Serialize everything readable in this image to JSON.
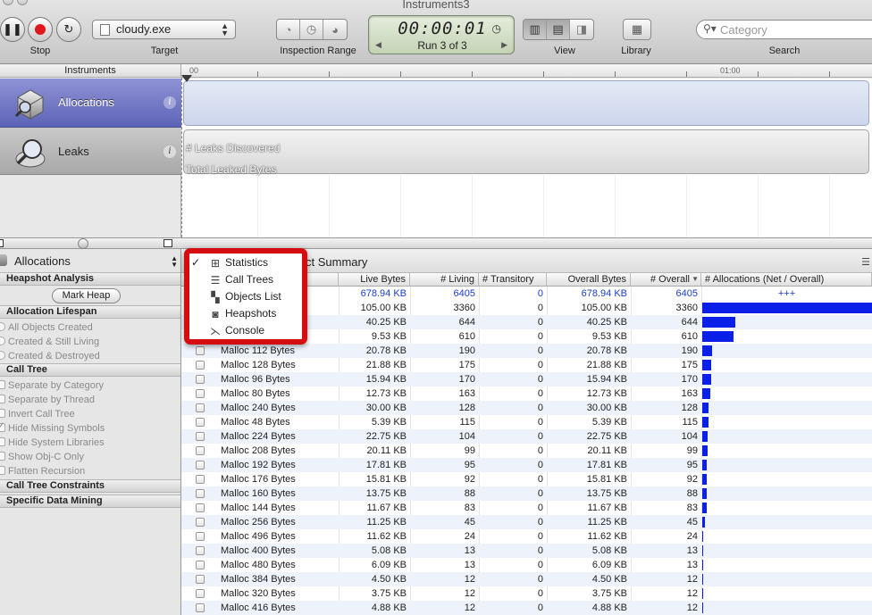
{
  "window": {
    "title": "Instruments3"
  },
  "toolbar": {
    "stop_label": "Stop",
    "target_label": "Target",
    "target_value": "cloudy.exe",
    "inspection_range_label": "Inspection Range",
    "timer": "00:00:01",
    "run": "Run 3 of 3",
    "view_label": "View",
    "library_label": "Library",
    "search_label": "Search",
    "search_placeholder": "Category"
  },
  "ruler": {
    "start": "00",
    "mark": "01:00"
  },
  "instruments": {
    "header": "Instruments",
    "items": [
      {
        "name": "Allocations"
      },
      {
        "name": "Leaks"
      }
    ],
    "leaks_track": {
      "line1": "# Leaks Discovered",
      "line2": "Total Leaked Bytes"
    }
  },
  "left_panel": {
    "popup": "Allocations",
    "heapshot_header": "Heapshot Analysis",
    "mark_heap": "Mark Heap",
    "lifespan_header": "Allocation Lifespan",
    "lifespan_options": [
      "All Objects Created",
      "Created & Still Living",
      "Created & Destroyed"
    ],
    "calltree_header": "Call Tree",
    "calltree_options": [
      {
        "label": "Separate by Category",
        "checked": false
      },
      {
        "label": "Separate by Thread",
        "checked": false
      },
      {
        "label": "Invert Call Tree",
        "checked": false
      },
      {
        "label": "Hide Missing Symbols",
        "checked": true
      },
      {
        "label": "Hide System Libraries",
        "checked": false
      },
      {
        "label": "Show Obj-C Only",
        "checked": false
      },
      {
        "label": "Flatten Recursion",
        "checked": false
      }
    ],
    "constraints_header": "Call Tree Constraints",
    "mining_header": "Specific Data Mining"
  },
  "detail": {
    "summary_suffix": "ct Summary"
  },
  "menu": {
    "items": [
      {
        "label": "Statistics",
        "checked": true,
        "icon": "grid-icon"
      },
      {
        "label": "Call Trees",
        "checked": false,
        "icon": "list-icon"
      },
      {
        "label": "Objects List",
        "checked": false,
        "icon": "objects-icon"
      },
      {
        "label": "Heapshots",
        "checked": false,
        "icon": "camera-icon"
      },
      {
        "label": "Console",
        "checked": false,
        "icon": "console-icon"
      }
    ]
  },
  "table": {
    "columns": [
      "Live Bytes",
      "# Living",
      "# Transitory",
      "Overall Bytes",
      "# Overall",
      "# Allocations (Net / Overall)"
    ],
    "total": {
      "live": "678.94 KB",
      "living": "6405",
      "transitory": "0",
      "overall_bytes": "678.94 KB",
      "overall": "6405",
      "alloc": "+++"
    },
    "rows": [
      {
        "name": "",
        "live": "105.00 KB",
        "living": "3360",
        "transitory": "0",
        "overall_bytes": "105.00 KB",
        "overall": "3360"
      },
      {
        "name": "",
        "live": "40.25 KB",
        "living": "644",
        "transitory": "0",
        "overall_bytes": "40.25 KB",
        "overall": "644"
      },
      {
        "name": "",
        "live": "9.53 KB",
        "living": "610",
        "transitory": "0",
        "overall_bytes": "9.53 KB",
        "overall": "610"
      },
      {
        "name": "Malloc 112 Bytes",
        "live": "20.78 KB",
        "living": "190",
        "transitory": "0",
        "overall_bytes": "20.78 KB",
        "overall": "190"
      },
      {
        "name": "Malloc 128 Bytes",
        "live": "21.88 KB",
        "living": "175",
        "transitory": "0",
        "overall_bytes": "21.88 KB",
        "overall": "175"
      },
      {
        "name": "Malloc 96 Bytes",
        "live": "15.94 KB",
        "living": "170",
        "transitory": "0",
        "overall_bytes": "15.94 KB",
        "overall": "170"
      },
      {
        "name": "Malloc 80 Bytes",
        "live": "12.73 KB",
        "living": "163",
        "transitory": "0",
        "overall_bytes": "12.73 KB",
        "overall": "163"
      },
      {
        "name": "Malloc 240 Bytes",
        "live": "30.00 KB",
        "living": "128",
        "transitory": "0",
        "overall_bytes": "30.00 KB",
        "overall": "128"
      },
      {
        "name": "Malloc 48 Bytes",
        "live": "5.39 KB",
        "living": "115",
        "transitory": "0",
        "overall_bytes": "5.39 KB",
        "overall": "115"
      },
      {
        "name": "Malloc 224 Bytes",
        "live": "22.75 KB",
        "living": "104",
        "transitory": "0",
        "overall_bytes": "22.75 KB",
        "overall": "104"
      },
      {
        "name": "Malloc 208 Bytes",
        "live": "20.11 KB",
        "living": "99",
        "transitory": "0",
        "overall_bytes": "20.11 KB",
        "overall": "99"
      },
      {
        "name": "Malloc 192 Bytes",
        "live": "17.81 KB",
        "living": "95",
        "transitory": "0",
        "overall_bytes": "17.81 KB",
        "overall": "95"
      },
      {
        "name": "Malloc 176 Bytes",
        "live": "15.81 KB",
        "living": "92",
        "transitory": "0",
        "overall_bytes": "15.81 KB",
        "overall": "92"
      },
      {
        "name": "Malloc 160 Bytes",
        "live": "13.75 KB",
        "living": "88",
        "transitory": "0",
        "overall_bytes": "13.75 KB",
        "overall": "88"
      },
      {
        "name": "Malloc 144 Bytes",
        "live": "11.67 KB",
        "living": "83",
        "transitory": "0",
        "overall_bytes": "11.67 KB",
        "overall": "83"
      },
      {
        "name": "Malloc 256 Bytes",
        "live": "11.25 KB",
        "living": "45",
        "transitory": "0",
        "overall_bytes": "11.25 KB",
        "overall": "45"
      },
      {
        "name": "Malloc 496 Bytes",
        "live": "11.62 KB",
        "living": "24",
        "transitory": "0",
        "overall_bytes": "11.62 KB",
        "overall": "24"
      },
      {
        "name": "Malloc 400 Bytes",
        "live": "5.08 KB",
        "living": "13",
        "transitory": "0",
        "overall_bytes": "5.08 KB",
        "overall": "13"
      },
      {
        "name": "Malloc 480 Bytes",
        "live": "6.09 KB",
        "living": "13",
        "transitory": "0",
        "overall_bytes": "6.09 KB",
        "overall": "13"
      },
      {
        "name": "Malloc 384 Bytes",
        "live": "4.50 KB",
        "living": "12",
        "transitory": "0",
        "overall_bytes": "4.50 KB",
        "overall": "12"
      },
      {
        "name": "Malloc 320 Bytes",
        "live": "3.75 KB",
        "living": "12",
        "transitory": "0",
        "overall_bytes": "3.75 KB",
        "overall": "12"
      },
      {
        "name": "Malloc 416 Bytes",
        "live": "4.88 KB",
        "living": "12",
        "transitory": "0",
        "overall_bytes": "4.88 KB",
        "overall": "12"
      }
    ]
  },
  "colors": {
    "bar": "#0a1fe8",
    "total_text": "#1a3fcc",
    "menu_outline": "#d50d10"
  }
}
